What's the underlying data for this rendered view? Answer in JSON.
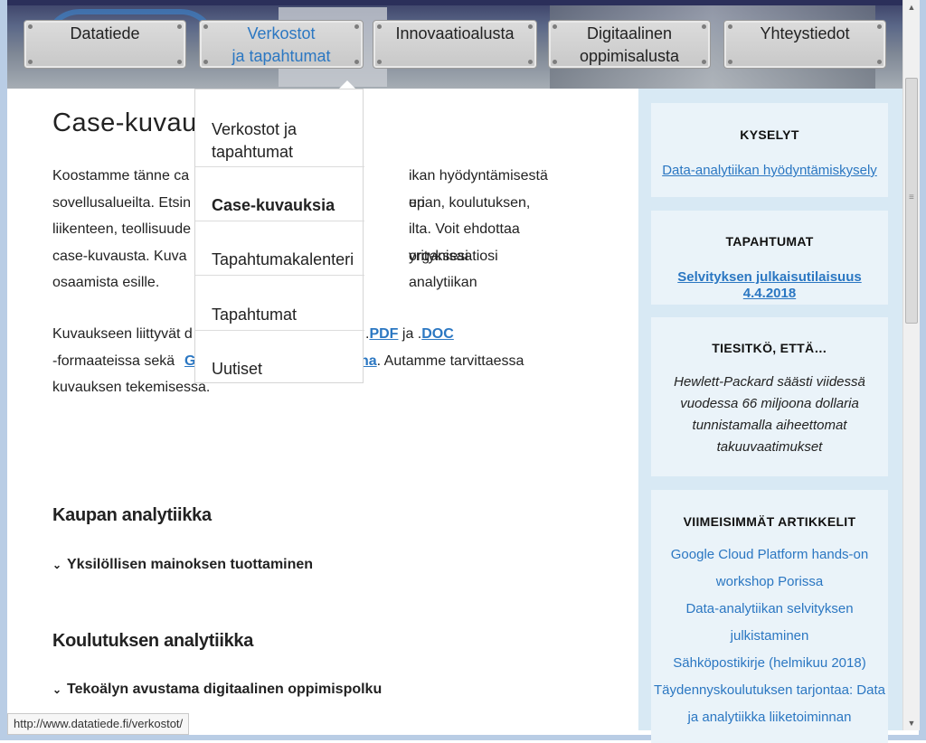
{
  "nav": {
    "items": [
      {
        "label": "Datatiede",
        "active": false
      },
      {
        "label": "Verkostot\nja tapahtumat",
        "active": true
      },
      {
        "label": "Innovaatioalusta",
        "active": false
      },
      {
        "label": "Digitaalinen\noppimisalusta",
        "active": false
      },
      {
        "label": "Yhteystiedot",
        "active": false
      }
    ]
  },
  "dropdown": {
    "items": [
      "Verkostot ja tapahtumat",
      "Case-kuvauksia",
      "Tapahtumakalenteri",
      "Tapahtumat",
      "Uutiset"
    ]
  },
  "main": {
    "title": "Case-kuvau",
    "intro_lines": [
      "Koostamme tänne ca",
      "ikan hyödyntämisestä eri",
      "sovellusalueilta. Etsin",
      "upan, koulutuksen,",
      "liikenteen, teollisuude",
      "ilta. Voit ehdottaa yrityksesi",
      "case-kuvausta. Kuva",
      "organisaatiosi analytiikan",
      "osaamista esille."
    ],
    "para2": {
      "prefix": "Kuvaukseen liittyvät d",
      "pdf": "PDF",
      "and": "ja",
      "doc": "DOC",
      "line2_prefix": "-formaateissa sekä",
      "g_link": "G",
      "na_link": "na",
      "line2_suffix": ". Autamme tarvittaessa",
      "line3": "kuvauksen tekemisessä."
    },
    "sections": [
      {
        "heading": "Kaupan analytiikka",
        "item": "Yksilöllisen mainoksen tuottaminen"
      },
      {
        "heading": "Koulutuksen analytiikka",
        "item": "Tekoälyn avustama digitaalinen oppimispolku"
      }
    ]
  },
  "sidebar": {
    "surveys_title": "KYSELYT",
    "surveys_link": "Data-analytiikan hyödyntämiskysely",
    "events_title": "TAPAHTUMAT",
    "events_link": "Selvityksen julkaisutilaisuus 4.4.2018",
    "fact_title": "TIESITKÖ, ETTÄ…",
    "fact_text": "Hewlett-Packard säästi viidessä vuodessa 66 miljoona dollaria tunnistamalla aiheettomat takuuvaatimukset",
    "articles_title": "VIIMEISIMMÄT ARTIKKELIT",
    "articles": [
      "Google Cloud Platform hands-on workshop Porissa",
      "Data-analytiikan selvityksen julkistaminen",
      "Sähköpostikirje (helmikuu 2018)",
      "Täydennyskoulutuksen tarjontaa: Data ja analytiikka liiketoiminnan"
    ]
  },
  "status_url": "http://www.datatiede.fi/verkostot/",
  "colors": {
    "link": "#2b77c2",
    "sidebar_bg": "#d8e9f4",
    "box_bg": "#eaf3f9"
  }
}
